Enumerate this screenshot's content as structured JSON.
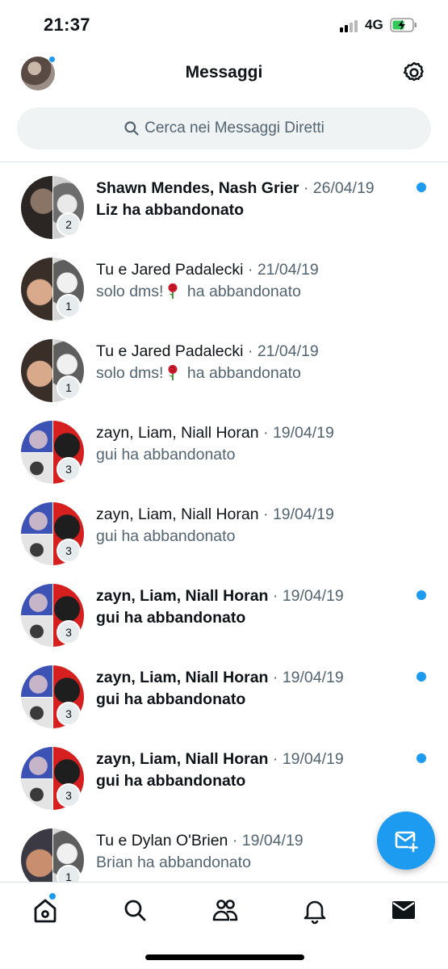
{
  "status_bar": {
    "time": "21:37",
    "network": "4G"
  },
  "header": {
    "title": "Messaggi"
  },
  "search": {
    "placeholder": "Cerca nei Messaggi Diretti"
  },
  "conversations": [
    {
      "name": "Shawn Mendes, Nash Grier",
      "date": "26/04/19",
      "preview": "Liz ha abbandonato",
      "count": "2",
      "unread": true
    },
    {
      "name": "Tu e Jared Padalecki",
      "date": "21/04/19",
      "preview_before": "solo dms!",
      "preview_emoji": "rose",
      "preview_after": " ha abbandonato",
      "count": "1",
      "unread": false
    },
    {
      "name": "Tu e Jared Padalecki",
      "date": "21/04/19",
      "preview_before": "solo dms!",
      "preview_emoji": "rose",
      "preview_after": " ha abbandonato",
      "count": "1",
      "unread": false
    },
    {
      "name": "zayn, Liam, Niall Horan",
      "date": "19/04/19",
      "preview": "gui ha abbandonato",
      "count": "3",
      "unread": false
    },
    {
      "name": "zayn, Liam, Niall Horan",
      "date": "19/04/19",
      "preview": "gui ha abbandonato",
      "count": "3",
      "unread": false
    },
    {
      "name": "zayn, Liam, Niall Horan",
      "date": "19/04/19",
      "preview": "gui ha abbandonato",
      "count": "3",
      "unread": true
    },
    {
      "name": "zayn, Liam, Niall Horan",
      "date": "19/04/19",
      "preview": "gui ha abbandonato",
      "count": "3",
      "unread": true
    },
    {
      "name": "zayn, Liam, Niall Horan",
      "date": "19/04/19",
      "preview": "gui ha abbandonato",
      "count": "3",
      "unread": true
    },
    {
      "name": "Tu e Dylan O'Brien",
      "date": "19/04/19",
      "preview": "Brian ha abbandonato",
      "count": "1",
      "unread": false
    }
  ],
  "separator": " · ",
  "icons": {
    "settings": "gear-icon",
    "search": "search-icon",
    "fab": "new-message-icon",
    "nav": [
      "home-icon",
      "search-icon",
      "communities-icon",
      "notifications-icon",
      "messages-icon"
    ]
  },
  "colors": {
    "accent": "#1d9bf0",
    "text": "#0f1419",
    "secondary": "#536471",
    "search_bg": "#eff3f4"
  }
}
